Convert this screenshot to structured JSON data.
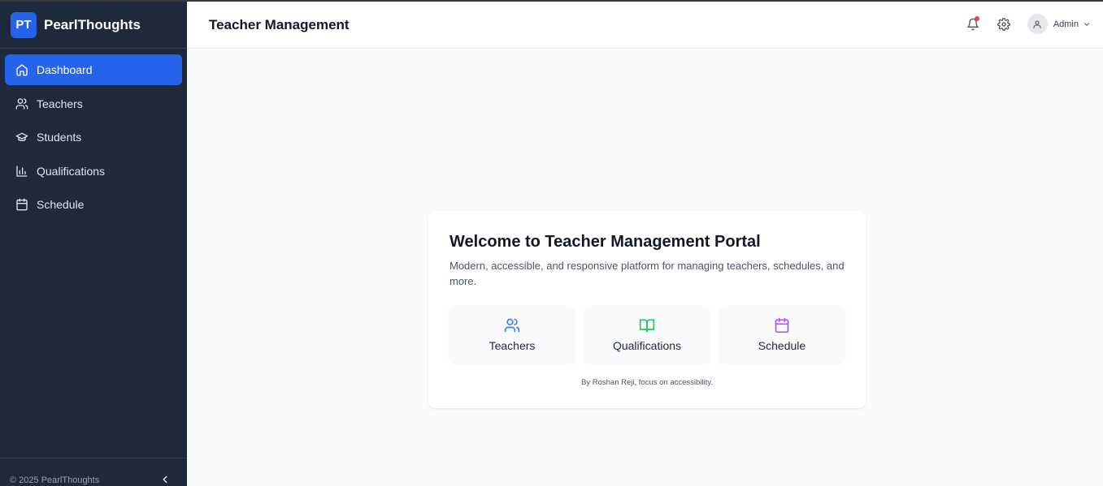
{
  "brand": {
    "logo": "PT",
    "name": "PearlThoughts"
  },
  "sidebar": {
    "items": [
      {
        "label": "Dashboard",
        "icon": "home-icon",
        "active": true
      },
      {
        "label": "Teachers",
        "icon": "users-icon"
      },
      {
        "label": "Students",
        "icon": "graduation-cap-icon"
      },
      {
        "label": "Qualifications",
        "icon": "bar-chart-icon"
      },
      {
        "label": "Schedule",
        "icon": "calendar-icon"
      }
    ],
    "footer": "© 2025 PearlThoughts",
    "collapse_icon": "chevron-left-icon"
  },
  "header": {
    "title": "Teacher Management",
    "user_name": "Admin",
    "icons": [
      "bell-icon",
      "gear-icon",
      "user-icon",
      "chevron-down-icon"
    ],
    "notification_color": "#ef4444"
  },
  "welcome": {
    "title": "Welcome to Teacher Management Portal",
    "subtitle": "Modern, accessible, and responsive platform for managing teachers, schedules, and more.",
    "tiles": [
      {
        "label": "Teachers",
        "icon": "users-icon",
        "color": "#3b82f6"
      },
      {
        "label": "Qualifications",
        "icon": "book-open-icon",
        "color": "#22c55e"
      },
      {
        "label": "Schedule",
        "icon": "calendar-icon",
        "color": "#a855f7"
      }
    ],
    "credit": "By Roshan Reji, focus on accessibility."
  },
  "colors": {
    "sidebar_bg": "#1e293b",
    "accent": "#2563eb",
    "page_bg": "#f8fafc"
  }
}
